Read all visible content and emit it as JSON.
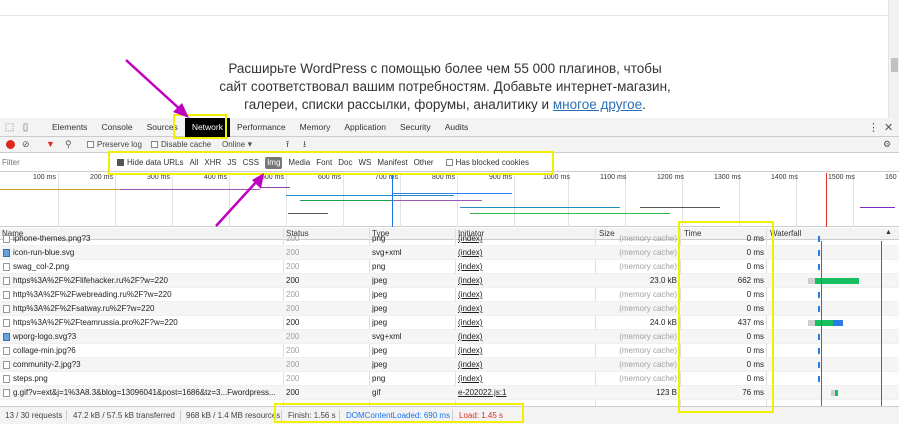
{
  "webpage": {
    "promo_line1": "Расширьте WordPress с помощью более чем 55 000 плагинов, чтобы",
    "promo_line2": "сайт соответствовал вашим потребностям. Добавьте интернет-магазин,",
    "promo_line3_before": "галереи, списки рассылки, форумы, аналитику и",
    "promo_link": "многое другое",
    "promo_line3_after": "."
  },
  "devtools": {
    "tabs": [
      "Elements",
      "Console",
      "Sources",
      "Network",
      "Performance",
      "Memory",
      "Application",
      "Security",
      "Audits"
    ],
    "active_tab": "Network",
    "toolbar": {
      "preserve_log": "Preserve log",
      "disable_cache": "Disable cache",
      "throttle": "Online"
    },
    "filter": {
      "placeholder": "Filter",
      "hide_data_urls": "Hide data URLs",
      "types": [
        "All",
        "XHR",
        "JS",
        "CSS",
        "Img",
        "Media",
        "Font",
        "Doc",
        "WS",
        "Manifest",
        "Other"
      ],
      "selected_type": "Img",
      "has_blocked_cookies": "Has blocked cookies"
    },
    "overview_ticks": [
      "100 ms",
      "200 ms",
      "300 ms",
      "400 ms",
      "500 ms",
      "600 ms",
      "700 ms",
      "800 ms",
      "900 ms",
      "1000 ms",
      "1100 ms",
      "1200 ms",
      "1300 ms",
      "1400 ms",
      "1500 ms",
      "160"
    ],
    "columns": {
      "name": "Name",
      "status": "Status",
      "type": "Type",
      "initiator": "Initiator",
      "size": "Size",
      "time": "Time",
      "waterfall": "Waterfall"
    },
    "rows": [
      {
        "name": "iphone-themes.png?3",
        "status": "200",
        "type": "png",
        "initiator": "(index)",
        "size": "(memory cache)",
        "time": "0 ms",
        "cached": true
      },
      {
        "name": "icon-run-blue.svg",
        "status": "200",
        "type": "svg+xml",
        "initiator": "(index)",
        "size": "(memory cache)",
        "time": "0 ms",
        "cached": true
      },
      {
        "name": "swag_col-2.png",
        "status": "200",
        "type": "png",
        "initiator": "(index)",
        "size": "(memory cache)",
        "time": "0 ms",
        "cached": true
      },
      {
        "name": "https%3A%2F%2Flifehacker.ru%2F?w=220",
        "status": "200",
        "type": "jpeg",
        "initiator": "(index)",
        "size": "23.0 kB",
        "time": "662 ms",
        "cached": false
      },
      {
        "name": "http%3A%2F%2Fwebreading.ru%2F?w=220",
        "status": "200",
        "type": "jpeg",
        "initiator": "(index)",
        "size": "(memory cache)",
        "time": "0 ms",
        "cached": true
      },
      {
        "name": "http%3A%2F%2Fsatway.ru%2F?w=220",
        "status": "200",
        "type": "jpeg",
        "initiator": "(index)",
        "size": "(memory cache)",
        "time": "0 ms",
        "cached": true
      },
      {
        "name": "https%3A%2F%2Fteamrussia.pro%2F?w=220",
        "status": "200",
        "type": "jpeg",
        "initiator": "(index)",
        "size": "24.0 kB",
        "time": "437 ms",
        "cached": false
      },
      {
        "name": "wporg-logo.svg?3",
        "status": "200",
        "type": "svg+xml",
        "initiator": "(index)",
        "size": "(memory cache)",
        "time": "0 ms",
        "cached": true
      },
      {
        "name": "collage-min.jpg?6",
        "status": "200",
        "type": "jpeg",
        "initiator": "(index)",
        "size": "(memory cache)",
        "time": "0 ms",
        "cached": true
      },
      {
        "name": "community-2.jpg?3",
        "status": "200",
        "type": "jpeg",
        "initiator": "(index)",
        "size": "(memory cache)",
        "time": "0 ms",
        "cached": true
      },
      {
        "name": "steps.png",
        "status": "200",
        "type": "png",
        "initiator": "(index)",
        "size": "(memory cache)",
        "time": "0 ms",
        "cached": true
      },
      {
        "name": "g.gif?v=ext&j=1%3A8.3&blog=13096041&post=1686&tz=3...Fwordpress...",
        "status": "200",
        "type": "gif",
        "initiator": "e-202022.js:1",
        "size": "123 B",
        "time": "76 ms",
        "cached": false
      }
    ],
    "status_bar": {
      "requests": "13 / 30 requests",
      "transferred": "47.2 kB / 57.5 kB transferred",
      "resources": "968 kB / 1.4 MB resources",
      "finish": "Finish: 1.56 s",
      "dom_content_loaded": "DOMContentLoaded: 690 ms",
      "load": "Load: 1.45 s"
    },
    "colors": {
      "highlight": "#f0f000",
      "arrow": "#c000c0",
      "dcl": "#1a73e8",
      "load": "#d93025"
    }
  }
}
